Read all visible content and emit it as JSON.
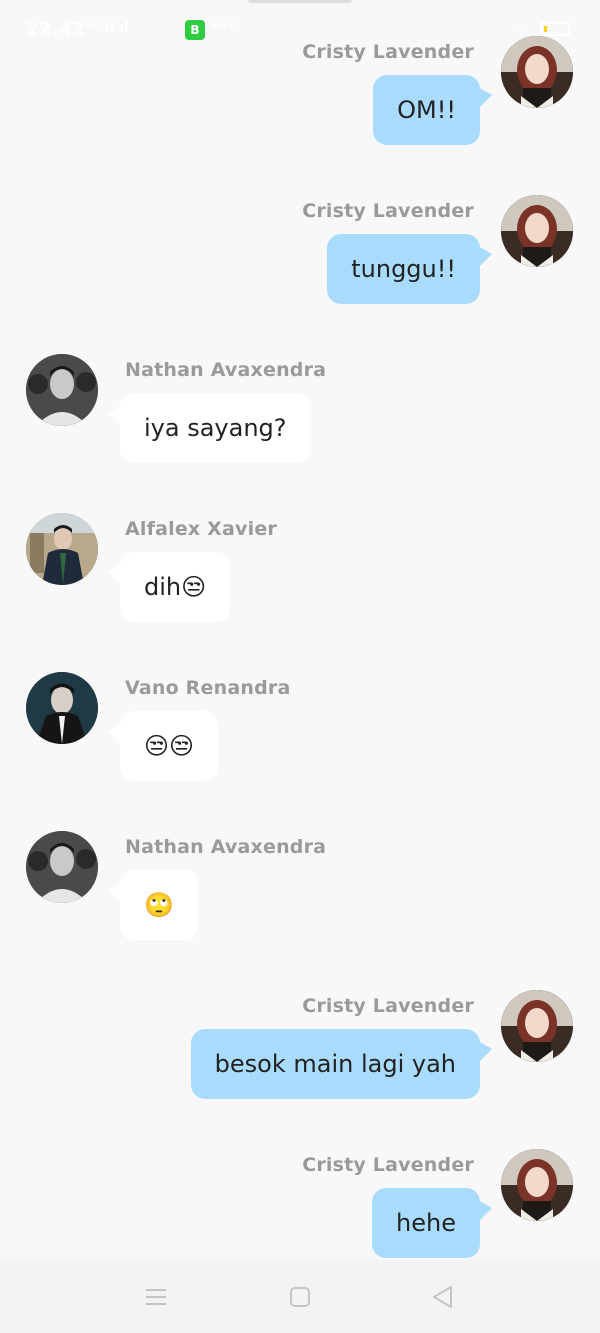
{
  "status_bar": {
    "time": "22.42",
    "signal": "ᵛᵒ ıl ıl",
    "app_badge": "B",
    "more": "•••",
    "wifi": "⌔",
    "battery_level": 0.15
  },
  "messages": [
    {
      "sender": "Cristy Lavender",
      "text": "OM!!",
      "side": "right",
      "avatar": "cristy-avatar"
    },
    {
      "sender": "Cristy Lavender",
      "text": "tunggu!!",
      "side": "right",
      "avatar": "cristy-avatar"
    },
    {
      "sender": "Nathan Avaxendra",
      "text": "iya sayang?",
      "side": "left",
      "avatar": "nathan-avatar"
    },
    {
      "sender": "Alfalex Xavier",
      "text": "dih😒",
      "side": "left",
      "avatar": "alfalex-avatar"
    },
    {
      "sender": "Vano Renandra",
      "text": "😒😒",
      "side": "left",
      "avatar": "vano-avatar"
    },
    {
      "sender": "Nathan Avaxendra",
      "text": "🙄",
      "side": "left",
      "avatar": "nathan-avatar"
    },
    {
      "sender": "Cristy Lavender",
      "text": "besok main lagi yah",
      "side": "right",
      "avatar": "cristy-avatar"
    },
    {
      "sender": "Cristy Lavender",
      "text": "hehe",
      "side": "right",
      "avatar": "cristy-avatar"
    }
  ],
  "nav_bar": {
    "menu_icon": "menu-icon",
    "home_icon": "home-icon",
    "back_icon": "back-icon"
  },
  "colors": {
    "background": "#f8f8f8",
    "bubble_self": "#a9dcfc",
    "bubble_other": "#ffffff",
    "sender_text": "#9a9a9a"
  }
}
